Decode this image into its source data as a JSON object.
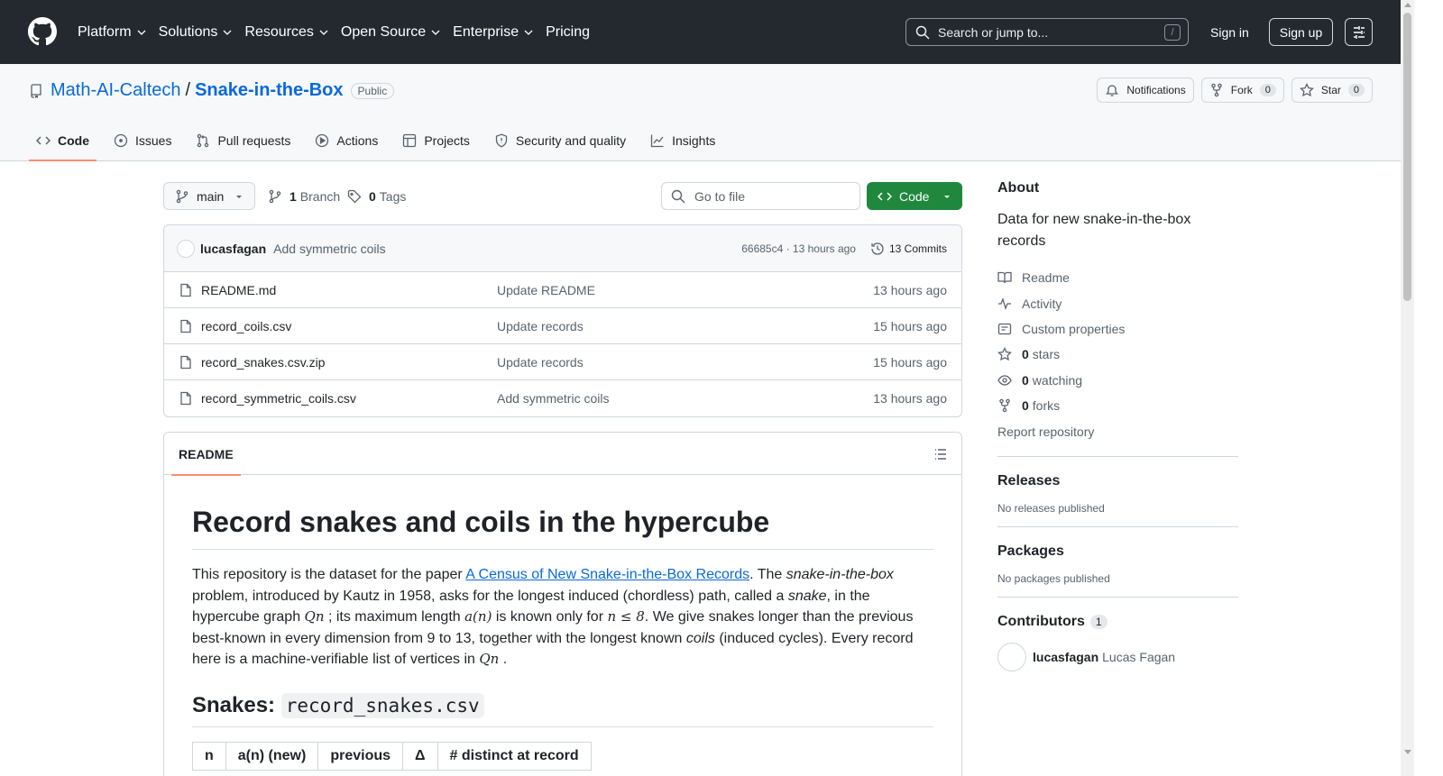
{
  "header": {
    "nav": [
      {
        "label": "Platform",
        "has_menu": true
      },
      {
        "label": "Solutions",
        "has_menu": true
      },
      {
        "label": "Resources",
        "has_menu": true
      },
      {
        "label": "Open Source",
        "has_menu": true
      },
      {
        "label": "Enterprise",
        "has_menu": true
      },
      {
        "label": "Pricing",
        "has_menu": false
      }
    ],
    "search_placeholder": "Search or jump to...",
    "search_shortcut": "/",
    "signin": "Sign in",
    "signup": "Sign up"
  },
  "repo": {
    "owner": "Math-AI-Caltech",
    "separator": "/",
    "name": "Snake-in-the-Box",
    "visibility": "Public",
    "notifications": "Notifications",
    "fork_label": "Fork",
    "fork_count": "0",
    "star_label": "Star",
    "star_count": "0",
    "tabs": [
      {
        "label": "Code",
        "icon": "code-icon",
        "active": true
      },
      {
        "label": "Issues",
        "icon": "issue-icon"
      },
      {
        "label": "Pull requests",
        "icon": "pull-request-icon"
      },
      {
        "label": "Actions",
        "icon": "play-icon"
      },
      {
        "label": "Projects",
        "icon": "table-icon"
      },
      {
        "label": "Security and quality",
        "icon": "shield-icon"
      },
      {
        "label": "Insights",
        "icon": "graph-icon"
      }
    ]
  },
  "filenav": {
    "branch": "main",
    "branches_count": "1",
    "branches_label": "Branch",
    "tags_count": "0",
    "tags_label": "Tags",
    "goto_placeholder": "Go to file",
    "code_button": "Code"
  },
  "commit": {
    "author": "lucasfagan",
    "message": "Add symmetric coils",
    "meta": "66685c4 · 13 hours ago",
    "commits": "13 Commits"
  },
  "files": [
    {
      "name": "README.md",
      "message": "Update README",
      "date": "13 hours ago"
    },
    {
      "name": "record_coils.csv",
      "message": "Update records",
      "date": "15 hours ago"
    },
    {
      "name": "record_snakes.csv.zip",
      "message": "Update records",
      "date": "15 hours ago"
    },
    {
      "name": "record_symmetric_coils.csv",
      "message": "Add symmetric coils",
      "date": "13 hours ago"
    }
  ],
  "readme": {
    "tab": "README",
    "title": "Record snakes and coils in the hypercube",
    "p1": "This repository is the dataset for the paper ",
    "p1_link": "A Census of New Snake-in-the-Box Records",
    "p1_b": ". The ",
    "p1_em1": "snake-in-the-box",
    "p1_c": " problem, introduced by Kautz in 1958, asks for the longest induced (chordless) path, called a ",
    "p1_em2": "snake",
    "p1_d": ", in the hypercube graph ",
    "m_qn": "Qn",
    "p1_e": " ; its maximum length ",
    "m_an": "a(n)",
    "p1_f": " is known only for ",
    "m_nle8": "n ≤ 8",
    "p1_g": ". We give snakes longer than the previous best-known in every dimension from 9 to 13, together with the longest known ",
    "p1_em3": "coils",
    "p1_h": " (induced cycles). Every record here is a machine-verifiable list of vertices in ",
    "m_qn2": "Qn",
    "p1_i": " .",
    "h2_prefix": "Snakes: ",
    "h2_code": "record_snakes.csv",
    "table_headers": [
      "n",
      "a(n) (new)",
      "previous",
      "Δ",
      "# distinct at record"
    ]
  },
  "sidebar": {
    "about": "About",
    "description": "Data for new snake-in-the-box records",
    "links": [
      {
        "label": "Readme",
        "icon": "book-icon"
      },
      {
        "label": "Activity",
        "icon": "pulse-icon"
      },
      {
        "label": "Custom properties",
        "icon": "note-icon"
      }
    ],
    "stars_count": "0",
    "stars_label": "stars",
    "watching_count": "0",
    "watching_label": "watching",
    "forks_count": "0",
    "forks_label": "forks",
    "report": "Report repository",
    "releases": "Releases",
    "no_releases": "No releases published",
    "packages": "Packages",
    "no_packages": "No packages published",
    "contributors": "Contributors",
    "contributors_count": "1",
    "contributor_login": "lucasfagan",
    "contributor_name": "Lucas Fagan"
  }
}
